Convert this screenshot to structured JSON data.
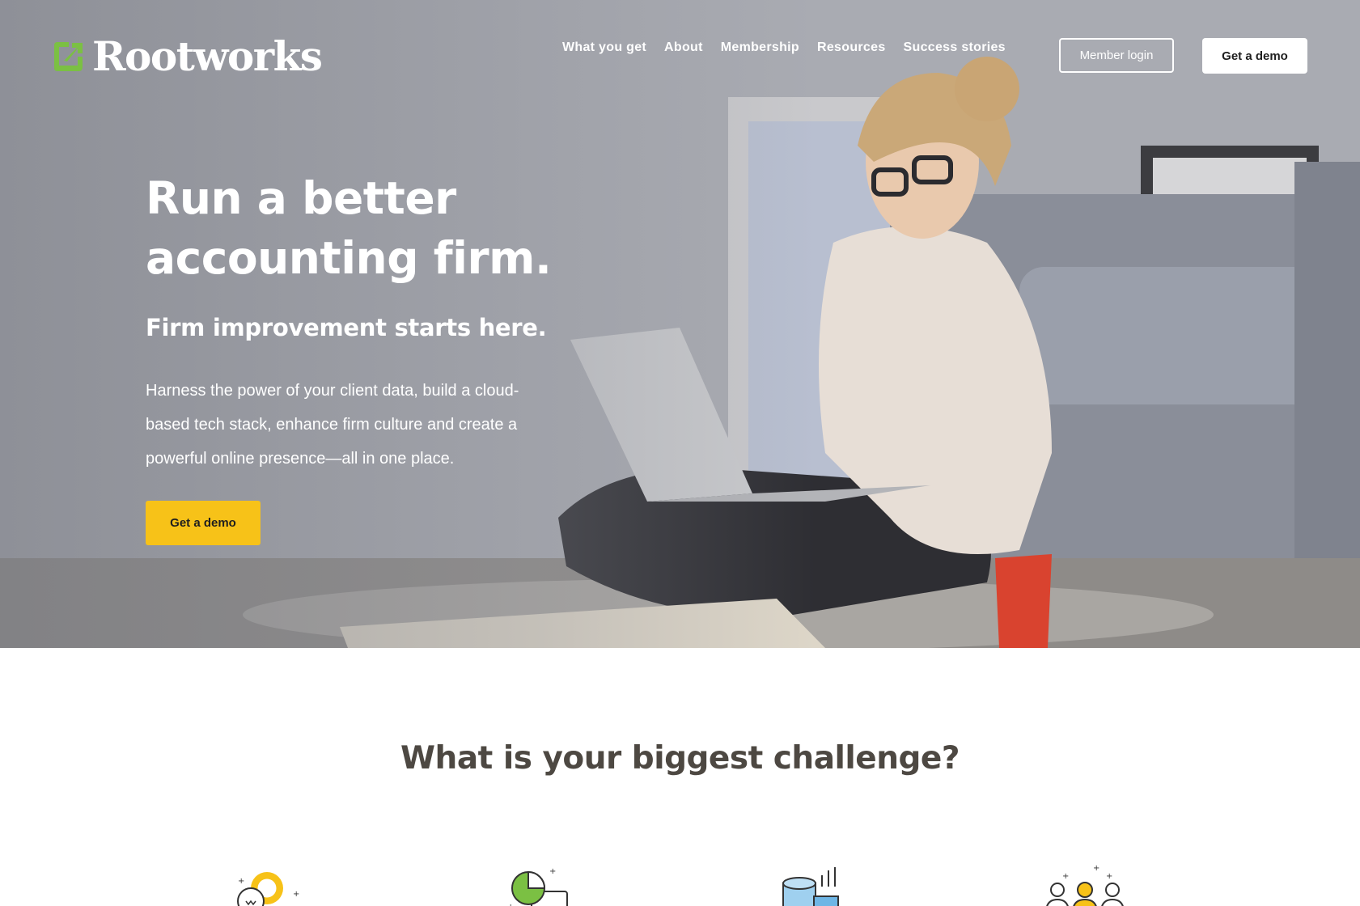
{
  "brand": {
    "name": "Rootworks",
    "logo_icon": "leaf-arrow-icon",
    "logo_color": "#7bc043"
  },
  "nav": {
    "items": [
      {
        "label": "What you get"
      },
      {
        "label": "About"
      },
      {
        "label": "Membership"
      },
      {
        "label": "Resources"
      },
      {
        "label": "Success stories"
      }
    ],
    "member_login": "Member login",
    "get_demo": "Get a demo"
  },
  "hero": {
    "title": "Run a better accounting firm.",
    "subtitle": "Firm improvement starts here.",
    "body": "Harness the power of your client data, build a cloud-based tech stack, enhance firm culture and create a powerful online presence—all in one place.",
    "cta": "Get a demo",
    "cta_color": "#f7c218"
  },
  "challenge": {
    "title": "What is your biggest challenge?",
    "icons": [
      "lightbulb-gear-icon",
      "pie-chart-screen-icon",
      "database-chart-icon",
      "team-people-icon"
    ]
  }
}
